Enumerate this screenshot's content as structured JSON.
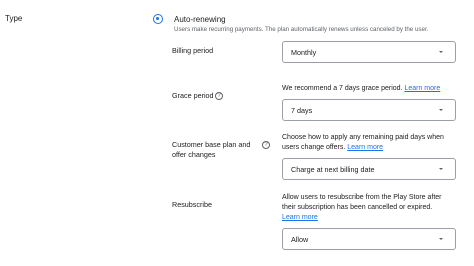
{
  "section": {
    "label": "Type"
  },
  "plan_type": {
    "selected_label": "Auto-renewing",
    "description": "Users make recurring payments. The plan automatically renews unless canceled by the user."
  },
  "billing_period": {
    "label": "Billing period",
    "value": "Monthly"
  },
  "grace_period": {
    "label": "Grace period",
    "hint": "We recommend a 7 days grace period.",
    "learn_more": "Learn more",
    "value": "7 days"
  },
  "base_plan_changes": {
    "label_line1": "Customer base plan and",
    "label_line2": "offer changes",
    "hint_line1": "Choose how to apply any remaining paid days when",
    "hint_line2": "users change offers.",
    "learn_more": "Learn more",
    "value": "Charge at next billing date"
  },
  "resubscribe": {
    "label": "Resubscribe",
    "hint_line1": "Allow users to resubscribe from the Play Store after",
    "hint_line2": "their subscription has been cancelled or expired.",
    "learn_more": "Learn more",
    "value": "Allow"
  },
  "icons": {
    "help": "help-icon",
    "dropdown": "chevron-down-icon",
    "radio": "radio-selected-icon"
  },
  "colors": {
    "accent": "#1a73e8",
    "text": "#202124",
    "secondary_text": "#5f6368",
    "border": "#9aa0a6"
  }
}
